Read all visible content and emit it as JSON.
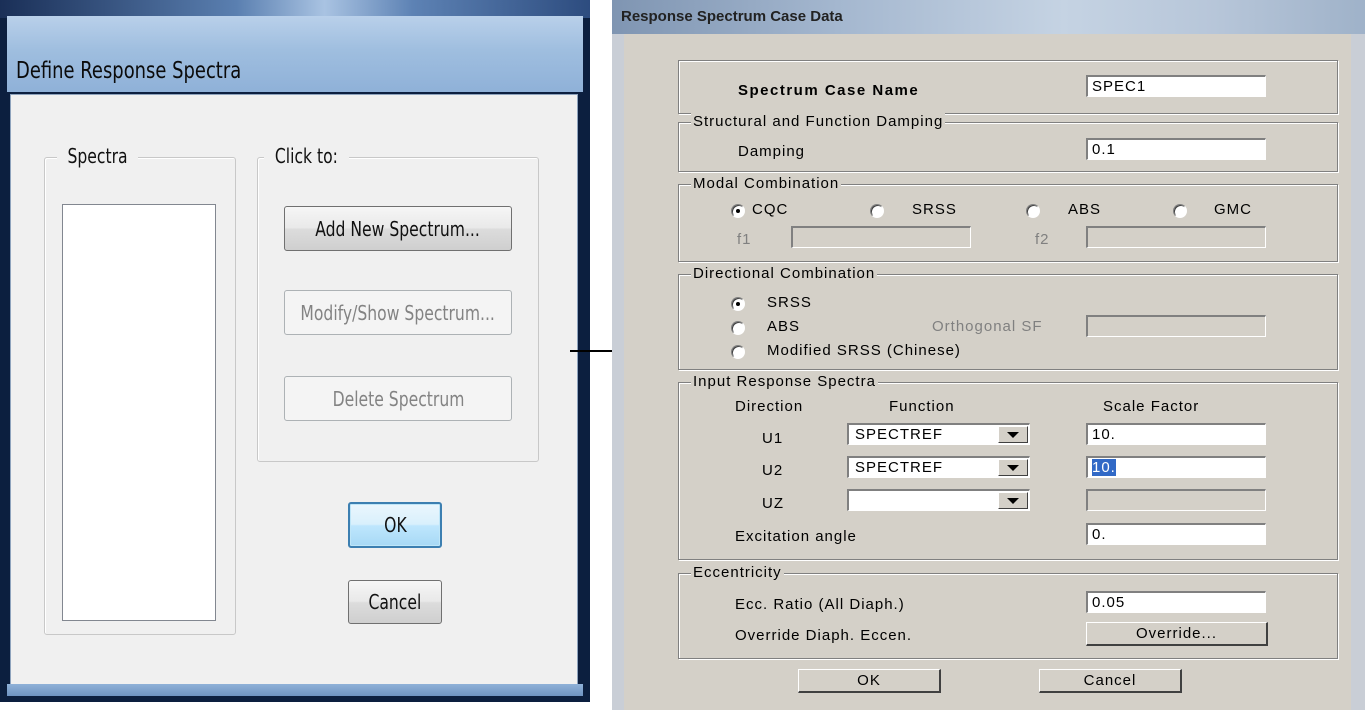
{
  "define_dialog": {
    "title": "Define Response Spectra",
    "spectra_group_label": "Spectra",
    "spectra_items": [],
    "click_group_label": "Click to:",
    "add_button": "Add New Spectrum...",
    "modify_button": "Modify/Show Spectrum...",
    "delete_button": "Delete Spectrum",
    "ok_button": "OK",
    "cancel_button": "Cancel"
  },
  "case_dialog": {
    "title": "Response Spectrum Case Data",
    "case_name_label": "Spectrum Case Name",
    "case_name_value": "SPEC1",
    "damping_group": "Structural and Function Damping",
    "damping_label": "Damping",
    "damping_value": "0.1",
    "modal_group": "Modal Combination",
    "modal_options": [
      "CQC",
      "SRSS",
      "ABS",
      "GMC"
    ],
    "modal_selected": "CQC",
    "f1_label": "f1",
    "f2_label": "f2",
    "directional_group": "Directional Combination",
    "dir_options": [
      "SRSS",
      "ABS",
      "Modified SRSS (Chinese)"
    ],
    "dir_selected": "SRSS",
    "orthogonal_label": "Orthogonal SF",
    "input_group": "Input Response Spectra",
    "col_direction": "Direction",
    "col_function": "Function",
    "col_scale": "Scale Factor",
    "rows": [
      {
        "direction": "U1",
        "function": "SPECTREF",
        "scale": "10."
      },
      {
        "direction": "U2",
        "function": "SPECTREF",
        "scale": "10."
      },
      {
        "direction": "UZ",
        "function": "",
        "scale": ""
      }
    ],
    "excitation_label": "Excitation  angle",
    "excitation_value": "0.",
    "eccentricity_group": "Eccentricity",
    "ecc_ratio_label": "Ecc. Ratio (All Diaph.)",
    "ecc_ratio_value": "0.05",
    "override_label": "Override Diaph. Eccen.",
    "override_button": "Override...",
    "ok_button": "OK",
    "cancel_button": "Cancel"
  }
}
